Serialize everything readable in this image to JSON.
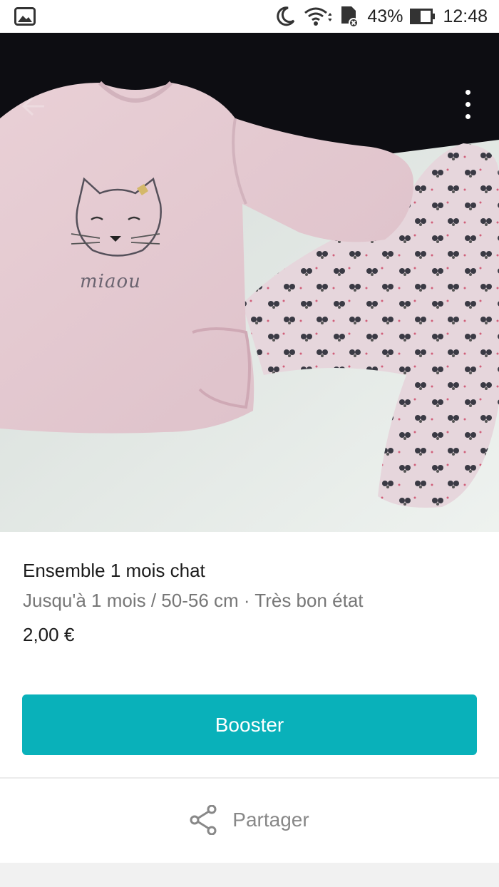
{
  "status_bar": {
    "battery_percent": "43%",
    "time": "12:48",
    "icons": [
      "gallery-icon",
      "moon-icon",
      "wifi-icon",
      "sd-card-icon",
      "battery-icon"
    ]
  },
  "photo": {
    "description_icons": [
      "back-arrow-icon",
      "more-vertical-icon"
    ],
    "shirt_print_text": "miaou"
  },
  "item": {
    "title": "Ensemble 1 mois chat",
    "details": "Jusqu'à 1 mois / 50-56 cm · Très bon état",
    "price": "2,00 €"
  },
  "actions": {
    "booster_label": "Booster",
    "share_label": "Partager"
  },
  "colors": {
    "accent": "#09b1ba",
    "muted_text": "#777777",
    "primary_text": "#1b1b1b"
  }
}
